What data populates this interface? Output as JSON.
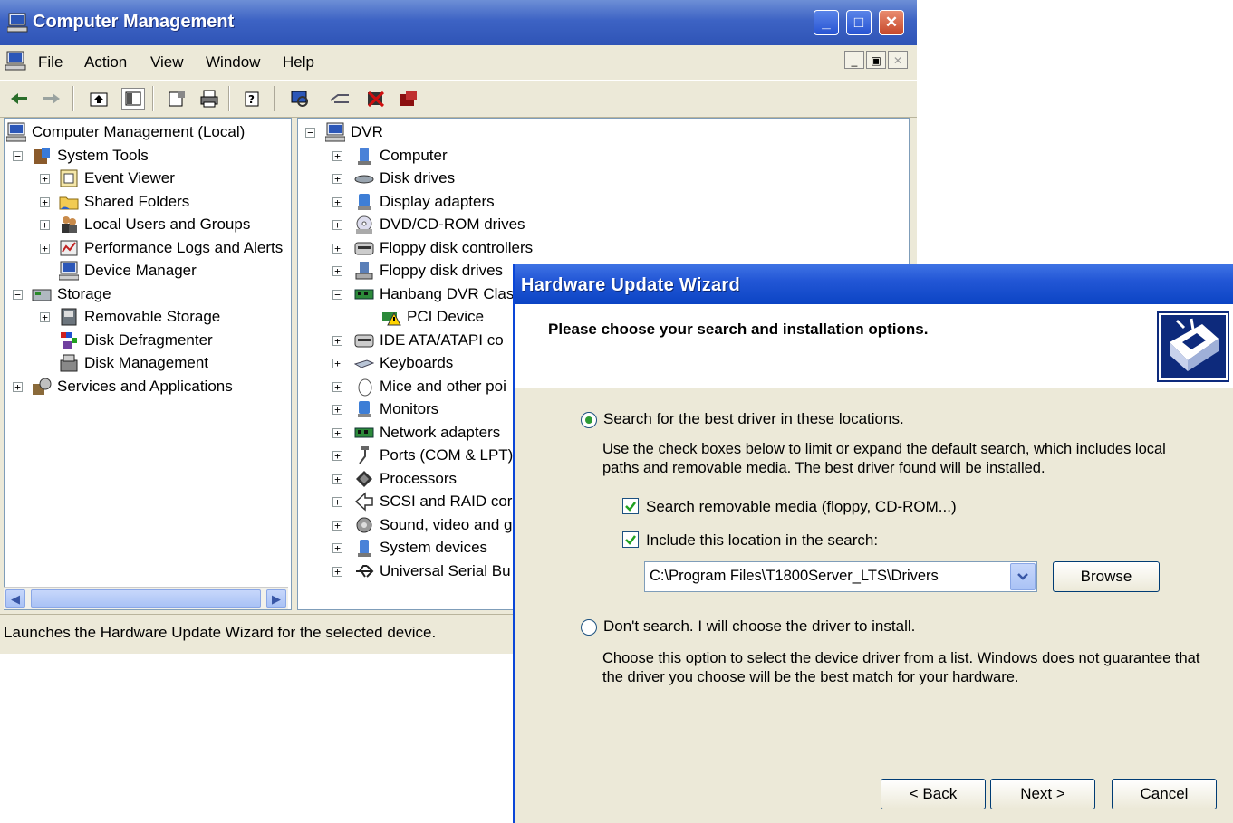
{
  "cm": {
    "title": "Computer Management",
    "menu": [
      "File",
      "Action",
      "View",
      "Window",
      "Help"
    ],
    "tree": [
      {
        "label": "Computer Management (Local)",
        "icon": "computer-icon"
      },
      {
        "label": "System Tools",
        "icon": "tools-icon"
      },
      {
        "label": "Event Viewer",
        "icon": "event-viewer-icon"
      },
      {
        "label": "Shared Folders",
        "icon": "shared-folder-icon"
      },
      {
        "label": "Local Users and Groups",
        "icon": "users-icon"
      },
      {
        "label": "Performance Logs and Alerts",
        "icon": "performance-icon"
      },
      {
        "label": "Device Manager",
        "icon": "device-manager-icon"
      },
      {
        "label": "Storage",
        "icon": "storage-icon"
      },
      {
        "label": "Removable Storage",
        "icon": "removable-storage-icon"
      },
      {
        "label": "Disk Defragmenter",
        "icon": "defrag-icon"
      },
      {
        "label": "Disk Management",
        "icon": "disk-management-icon"
      },
      {
        "label": "Services and Applications",
        "icon": "services-icon"
      }
    ],
    "devices": [
      {
        "label": "DVR",
        "icon": "computer-icon"
      },
      {
        "label": "Computer",
        "icon": "computer-icon"
      },
      {
        "label": "Disk drives",
        "icon": "disk-drive-icon"
      },
      {
        "label": "Display adapters",
        "icon": "display-icon"
      },
      {
        "label": "DVD/CD-ROM drives",
        "icon": "cdrom-icon"
      },
      {
        "label": "Floppy disk controllers",
        "icon": "floppy-controller-icon"
      },
      {
        "label": "Floppy disk drives",
        "icon": "floppy-drive-icon"
      },
      {
        "label": "Hanbang DVR Clas",
        "icon": "board-icon"
      },
      {
        "label": "PCI Device",
        "icon": "warning-device-icon"
      },
      {
        "label": "IDE ATA/ATAPI co",
        "icon": "ide-icon"
      },
      {
        "label": "Keyboards",
        "icon": "keyboard-icon"
      },
      {
        "label": "Mice and other poi",
        "icon": "mouse-icon"
      },
      {
        "label": "Monitors",
        "icon": "monitor-icon"
      },
      {
        "label": "Network adapters",
        "icon": "network-icon"
      },
      {
        "label": "Ports (COM & LPT)",
        "icon": "port-icon"
      },
      {
        "label": "Processors",
        "icon": "processor-icon"
      },
      {
        "label": "SCSI and RAID cor",
        "icon": "scsi-icon"
      },
      {
        "label": "Sound, video and g",
        "icon": "sound-icon"
      },
      {
        "label": "System devices",
        "icon": "system-icon"
      },
      {
        "label": "Universal Serial Bu",
        "icon": "usb-icon"
      }
    ],
    "status": "Launches the Hardware Update Wizard for the selected device."
  },
  "wizard": {
    "title": "Hardware Update Wizard",
    "heading": "Please choose your search and installation options.",
    "option_search": "Search for the best driver in these locations.",
    "search_desc_1": "Use the check boxes below to limit or expand the default search, which includes local",
    "search_desc_2": "paths and removable media. The best driver found will be installed.",
    "chk_removable": "Search removable media (floppy, CD-ROM...)",
    "chk_location": "Include this location in the search:",
    "location_value": "C:\\Program Files\\T1800Server_LTS\\Drivers",
    "browse": "Browse",
    "option_manual": "Don't search. I will choose the driver to install.",
    "manual_desc_1": "Choose this option to select the device driver from a list.  Windows does not guarantee that",
    "manual_desc_2": "the driver you choose will be the best match for your hardware.",
    "back": "< Back",
    "next": "Next >",
    "cancel": "Cancel"
  }
}
